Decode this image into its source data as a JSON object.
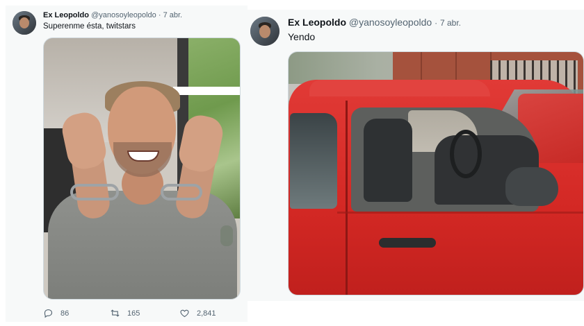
{
  "left_tweet": {
    "author_name": "Ex Leopoldo",
    "handle": "@yanosoyleopoldo",
    "separator": "·",
    "date": "7 abr.",
    "text": "Superenme ésta, twitstars",
    "actions": {
      "replies": "86",
      "retweets": "165",
      "likes": "2,841"
    },
    "icons": [
      "reply-icon",
      "retweet-icon",
      "like-icon"
    ]
  },
  "right_tweet": {
    "author_name": "Ex Leopoldo",
    "handle": "@yanosoyleopoldo",
    "separator": "·",
    "date": "7 abr.",
    "text": "Yendo"
  },
  "colors": {
    "name_text": "#0f1419",
    "secondary_text": "#536471",
    "car_red": "#d32824"
  }
}
